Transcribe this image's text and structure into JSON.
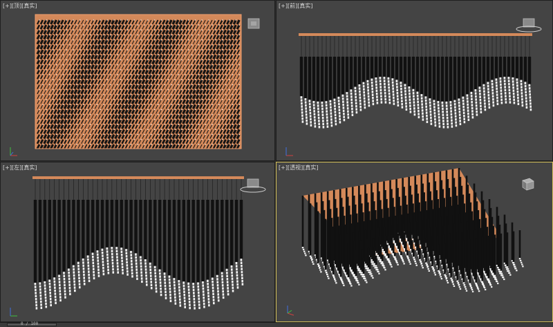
{
  "viewports": [
    {
      "id": "top",
      "labels": [
        "[+]",
        "[顶]",
        "[真实]"
      ]
    },
    {
      "id": "front",
      "labels": [
        "[+]",
        "[前]",
        "[真实]"
      ]
    },
    {
      "id": "left",
      "labels": [
        "[+]",
        "[左]",
        "[真实]"
      ]
    },
    {
      "id": "perspective",
      "labels": [
        "[+]",
        "[透视]",
        "[真实]"
      ]
    }
  ],
  "timeline": {
    "frame_readout": "0 / 100"
  },
  "colors": {
    "viewport_bg": "#444444",
    "wood": "#d4895a",
    "rod": "#111111",
    "bead": "#f2f2f2",
    "active_border": "#d6c25a"
  },
  "icons": {
    "navcube": "view-cube-icon",
    "axis": "axis-tripod-icon"
  }
}
